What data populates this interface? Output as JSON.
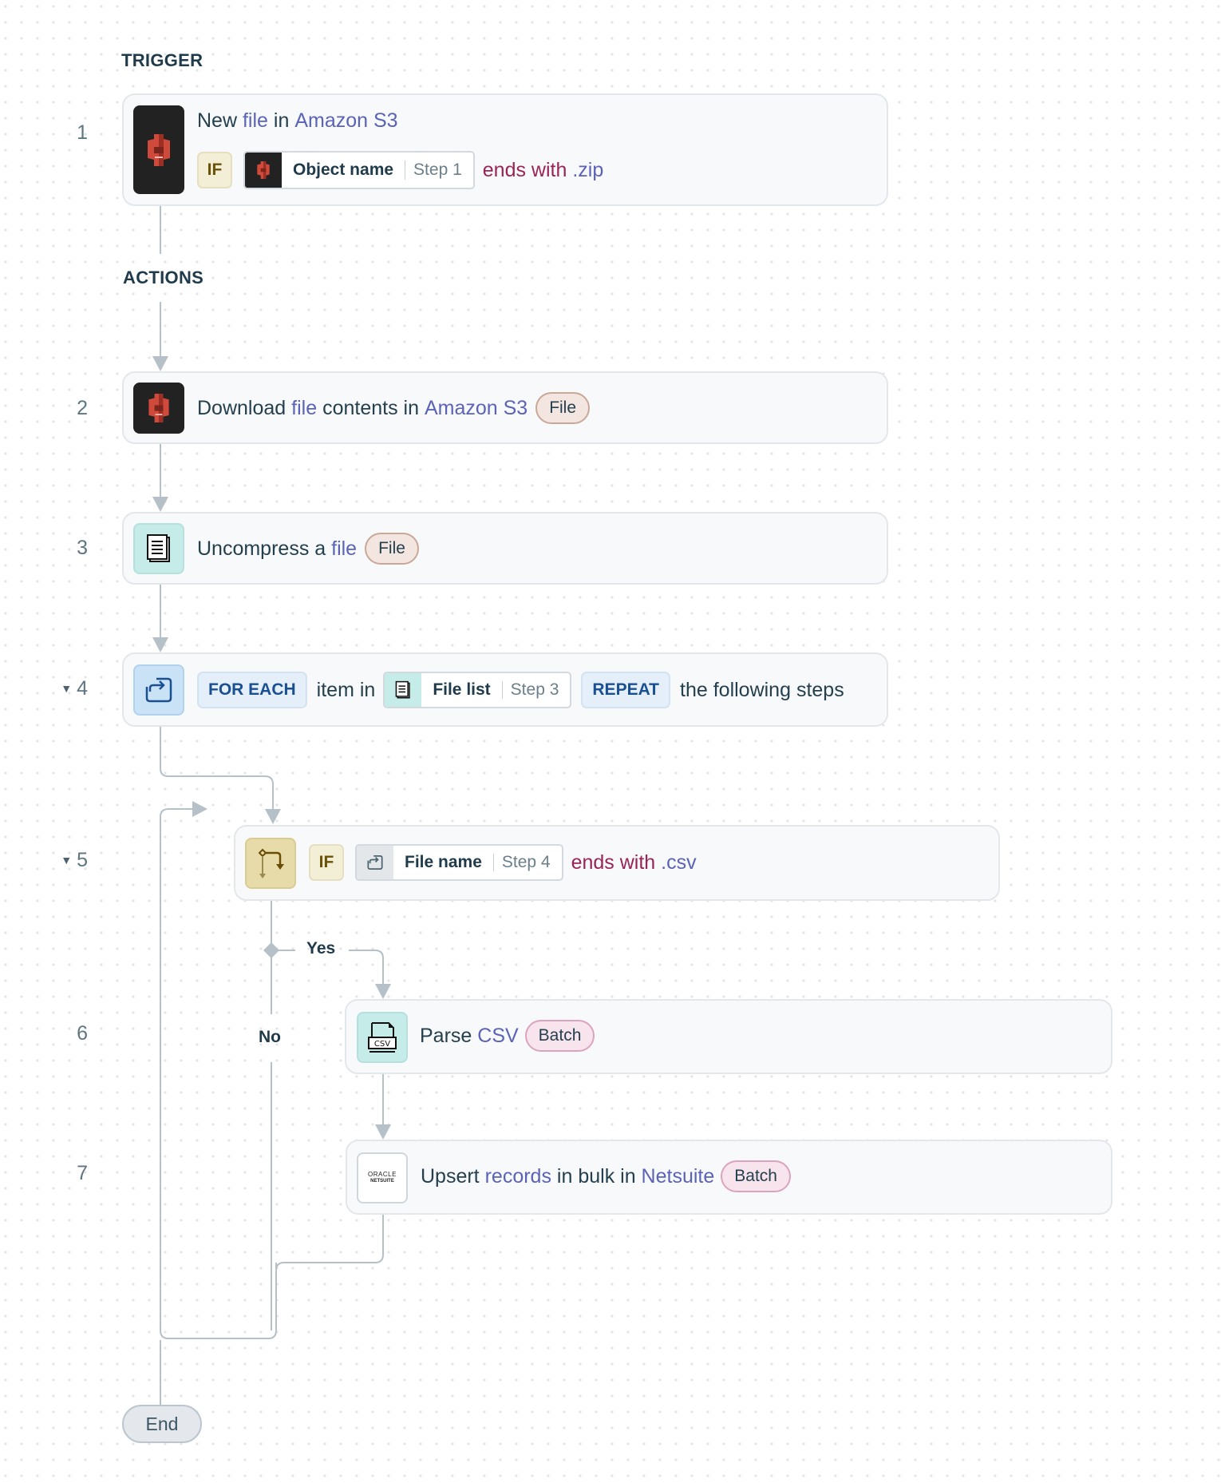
{
  "sections": {
    "trigger_label": "TRIGGER",
    "actions_label": "ACTIONS"
  },
  "steps": [
    {
      "number": "1",
      "icon": "amazon-s3-icon",
      "title": {
        "verb": "New",
        "object": "file",
        "prep": "in",
        "app": "Amazon S3"
      },
      "condition": {
        "if_label": "IF",
        "field_icon": "amazon-s3-icon",
        "field_name": "Object name",
        "field_step": "Step 1",
        "operator": "ends with",
        "value": ".zip"
      }
    },
    {
      "number": "2",
      "icon": "amazon-s3-icon",
      "title": {
        "verb": "Download",
        "object": "file",
        "rest": "contents in",
        "app": "Amazon S3"
      },
      "tag": "File"
    },
    {
      "number": "3",
      "icon": "file-document-icon",
      "title": {
        "verb": "Uncompress a",
        "object": "file"
      },
      "tag": "File"
    },
    {
      "number": "4",
      "collapsible": true,
      "icon": "repeat-loop-icon",
      "for_each_label": "FOR EACH",
      "item_in_text": "item in",
      "field_icon": "file-document-icon",
      "field_name": "File list",
      "field_step": "Step 3",
      "repeat_label": "REPEAT",
      "tail_text": "the following steps"
    },
    {
      "number": "5",
      "collapsible": true,
      "icon": "branch-condition-icon",
      "condition": {
        "if_label": "IF",
        "field_icon": "repeat-loop-icon",
        "field_name": "File name",
        "field_step": "Step 4",
        "operator": "ends with",
        "value": ".csv"
      },
      "yes_label": "Yes",
      "no_label": "No"
    },
    {
      "number": "6",
      "icon": "csv-file-icon",
      "title": {
        "verb": "Parse",
        "object": "CSV"
      },
      "tag": "Batch"
    },
    {
      "number": "7",
      "icon": "oracle-netsuite-logo",
      "icon_text": {
        "line1": "ORACLE",
        "line2": "NETSUITE"
      },
      "title": {
        "verb": "Upsert",
        "object": "records",
        "rest": "in bulk in",
        "app": "Netsuite"
      },
      "tag": "Batch"
    }
  ],
  "end_label": "End",
  "colors": {
    "highlight": "#5b63b7",
    "condition": "#9a2457",
    "connector": "#b6c0c9",
    "text": "#24404f"
  }
}
